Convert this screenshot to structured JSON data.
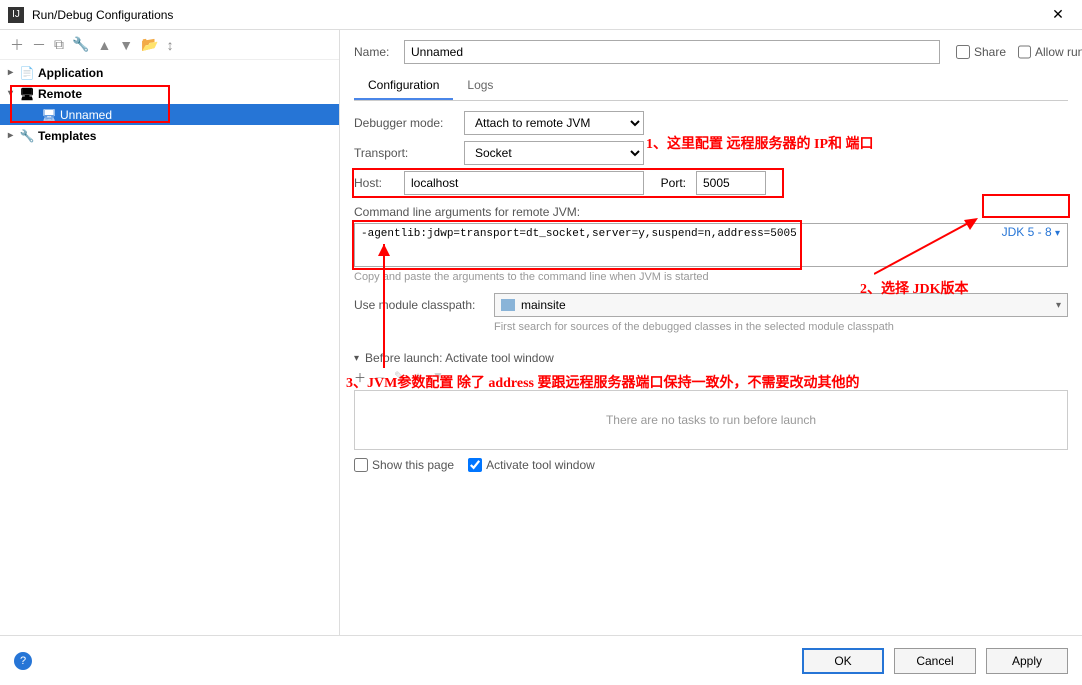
{
  "window": {
    "title": "Run/Debug Configurations"
  },
  "tree": {
    "app": "Application",
    "remote": "Remote",
    "unnamed": "Unnamed",
    "templates": "Templates"
  },
  "form": {
    "name_label": "Name:",
    "name_value": "Unnamed",
    "share": "Share",
    "allow_parallel": "Allow running in parallel",
    "tab_config": "Configuration",
    "tab_logs": "Logs",
    "debugger_mode_label": "Debugger mode:",
    "debugger_mode_value": "Attach to remote JVM",
    "transport_label": "Transport:",
    "transport_value": "Socket",
    "host_label": "Host:",
    "host_value": "localhost",
    "port_label": "Port:",
    "port_value": "5005",
    "cmdline_label": "Command line arguments for remote JVM:",
    "cmdline_value": "-agentlib:jdwp=transport=dt_socket,server=y,suspend=n,address=5005",
    "cmdline_hint": "Copy and paste the arguments to the command line when JVM is started",
    "jdk": "JDK 5 - 8",
    "classpath_label": "Use module classpath:",
    "classpath_value": "mainsite",
    "classpath_hint": "First search for sources of the debugged classes in the selected module classpath",
    "before_launch_header": "Before launch: Activate tool window",
    "no_tasks": "There are no tasks to run before launch",
    "show_page": "Show this page",
    "activate_window": "Activate tool window"
  },
  "buttons": {
    "ok": "OK",
    "cancel": "Cancel",
    "apply": "Apply"
  },
  "annotations": {
    "a1": "1、这里配置 远程服务器的 IP和 端口",
    "a2": "2、选择 JDK版本",
    "a3": "3、JVM参数配置 除了 address 要跟远程服务器端口保持一致外，不需要改动其他的"
  }
}
